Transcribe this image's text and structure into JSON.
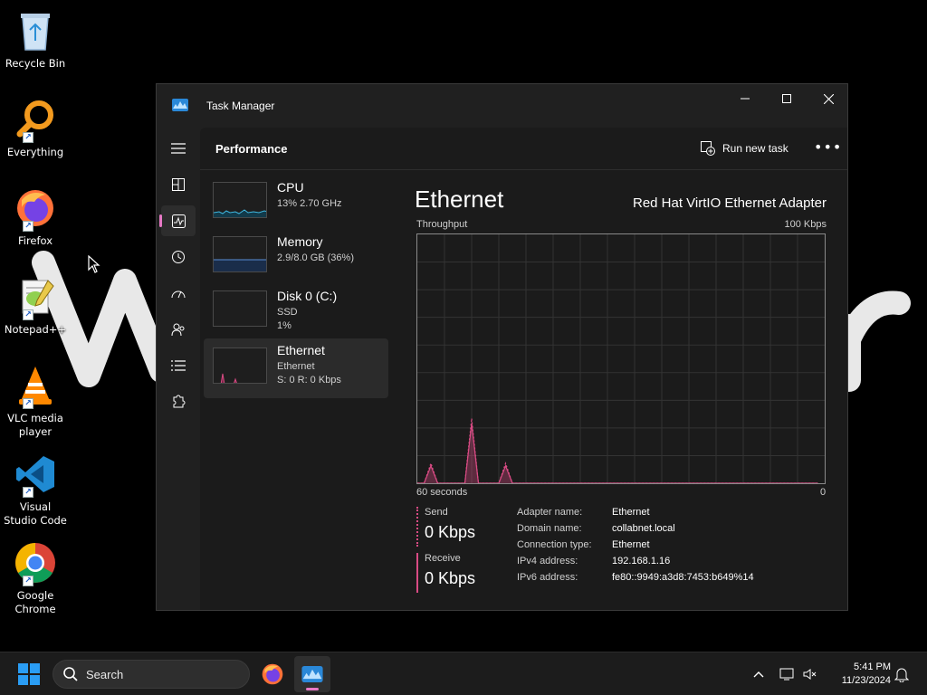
{
  "desktop": {
    "icons": [
      {
        "label": "Recycle Bin",
        "icon": "recycle-bin-icon"
      },
      {
        "label": "Everything",
        "icon": "everything-search-icon"
      },
      {
        "label": "Firefox",
        "icon": "firefox-icon"
      },
      {
        "label": "Notepad++",
        "icon": "notepad-plus-plus-icon"
      },
      {
        "label": "VLC media player",
        "icon": "vlc-icon"
      },
      {
        "label": "Visual Studio Code",
        "icon": "vscode-icon"
      },
      {
        "label": "Google Chrome",
        "icon": "chrome-icon"
      }
    ]
  },
  "window": {
    "title": "Task Manager",
    "page_title": "Performance",
    "run_new_task": "Run new task",
    "more": "•••"
  },
  "perf_list": [
    {
      "name": "CPU",
      "line1": "13% 2.70 GHz",
      "line2": ""
    },
    {
      "name": "Memory",
      "line1": "2.9/8.0 GB (36%)",
      "line2": ""
    },
    {
      "name": "Disk 0 (C:)",
      "line1": "SSD",
      "line2": "1%"
    },
    {
      "name": "Ethernet",
      "line1": "Ethernet",
      "line2": "S: 0 R: 0 Kbps"
    }
  ],
  "detail": {
    "title": "Ethernet",
    "adapter": "Red Hat VirtIO Ethernet Adapter",
    "graph_top_left": "Throughput",
    "graph_top_right": "100 Kbps",
    "graph_bottom_left": "60 seconds",
    "graph_bottom_right": "0",
    "send_label": "Send",
    "send_value": "0 Kbps",
    "receive_label": "Receive",
    "receive_value": "0 Kbps",
    "properties": [
      {
        "key": "Adapter name:",
        "value": "Ethernet"
      },
      {
        "key": "Domain name:",
        "value": "collabnet.local"
      },
      {
        "key": "Connection type:",
        "value": "Ethernet"
      },
      {
        "key": "IPv4 address:",
        "value": "192.168.1.16"
      },
      {
        "key": "IPv6 address:",
        "value": "fe80::9949:a3d8:7453:b649%14"
      }
    ]
  },
  "chart_data": {
    "type": "line",
    "title": "Throughput",
    "xlabel": "60 seconds",
    "ylabel": "",
    "xlim": [
      60,
      0
    ],
    "ylim": [
      0,
      100
    ],
    "series": [
      {
        "name": "Send",
        "x": [
          60,
          59,
          58,
          57,
          55,
          54,
          53,
          52,
          51,
          49,
          48,
          47,
          46,
          45,
          1
        ],
        "values": [
          0,
          0,
          8,
          0,
          0,
          0,
          0,
          26,
          0,
          0,
          0,
          8,
          0,
          0,
          0
        ]
      },
      {
        "name": "Receive",
        "x": [
          60,
          59,
          58,
          57,
          55,
          54,
          53,
          52,
          51,
          49,
          48,
          47,
          46,
          45,
          1
        ],
        "values": [
          0,
          0,
          7,
          0,
          0,
          0,
          0,
          24,
          0,
          0,
          0,
          7,
          0,
          0,
          0
        ]
      }
    ],
    "grid": true,
    "color": "#d94b84"
  },
  "taskbar": {
    "search_placeholder": "Search",
    "time": "5:41 PM",
    "date": "11/23/2024"
  }
}
